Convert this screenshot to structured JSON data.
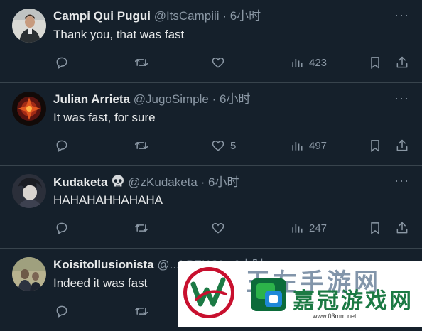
{
  "tweets": [
    {
      "name": "Campi Qui Pugui",
      "handle": "@ItsCampiii",
      "separator": "·",
      "time": "6小时",
      "text": "Thank you, that was fast",
      "likes": "",
      "views": "423"
    },
    {
      "name": "Julian Arrieta",
      "handle": "@JugoSimple",
      "separator": "·",
      "time": "6小时",
      "text": "It was fast, for sure",
      "likes": "5",
      "views": "497"
    },
    {
      "name": "Kudaketa",
      "handle": "@zKudaketa",
      "separator": "·",
      "time": "6小时",
      "text": "HAHAHAHHAHAHA",
      "likes": "",
      "views": "247"
    },
    {
      "name": "Koisitollusionista",
      "handle": "@...LPZKOI",
      "separator": "·",
      "time": "6小时",
      "text": "Indeed it was fast",
      "likes": "",
      "views": ""
    }
  ],
  "more_glyph": "···",
  "watermark": {
    "site_name": "嘉冠游戏网",
    "url": "www.03mm.net",
    "ghost_text": "王左手游网"
  },
  "colors": {
    "background": "#15202b",
    "text": "#e7e9ea",
    "secondary": "#8b98a5",
    "divider": "#38444d",
    "brand_green": "#1c7a44",
    "brand_red": "#c8102e"
  }
}
